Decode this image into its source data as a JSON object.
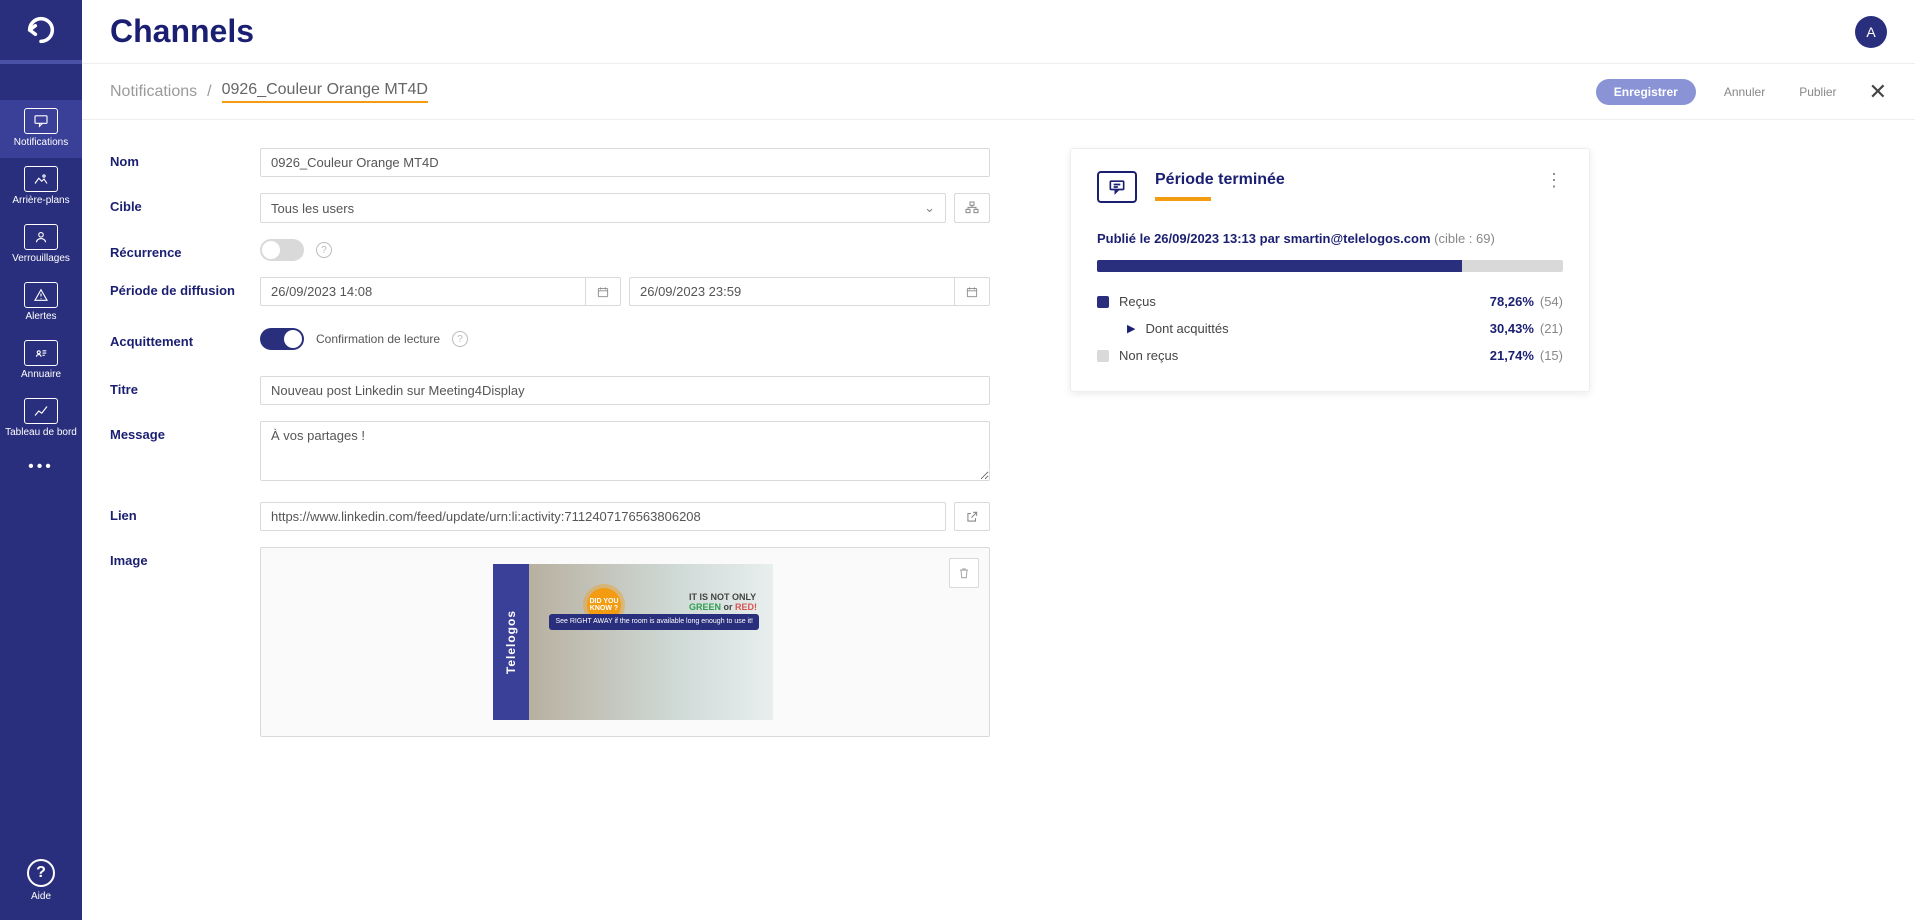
{
  "app": {
    "title": "Channels",
    "avatar": "A"
  },
  "breadcrumb": {
    "root": "Notifications",
    "leaf": "0926_Couleur Orange MT4D"
  },
  "actions": {
    "save": "Enregistrer",
    "cancel": "Annuler",
    "publish": "Publier"
  },
  "sidebar": {
    "items": [
      {
        "label": "Notifications"
      },
      {
        "label": "Arrière-plans"
      },
      {
        "label": "Verrouillages"
      },
      {
        "label": "Alertes"
      },
      {
        "label": "Annuaire"
      },
      {
        "label": "Tableau de bord"
      }
    ],
    "help": "Aide"
  },
  "form": {
    "labels": {
      "name": "Nom",
      "target": "Cible",
      "recurrence": "Récurrence",
      "period": "Période de diffusion",
      "ack": "Acquittement",
      "title": "Titre",
      "message": "Message",
      "link": "Lien",
      "image": "Image"
    },
    "values": {
      "name": "0926_Couleur Orange MT4D",
      "target": "Tous les users",
      "recurrence_on": false,
      "period_start": "26/09/2023 14:08",
      "period_end": "26/09/2023 23:59",
      "ack_on": true,
      "ack_label": "Confirmation de lecture",
      "title": "Nouveau post Linkedin sur Meeting4Display",
      "message": "À vos partages !",
      "link": "https://www.linkedin.com/feed/update/urn:li:activity:7112407176563806208"
    },
    "image_preview": {
      "brand": "Telelogos",
      "badge": "DID YOU KNOW ?",
      "line1": "IT IS NOT ONLY",
      "green": "GREEN",
      "or": " or ",
      "red": "RED!",
      "note": "See RIGHT AWAY if the room is available long enough to use it!"
    }
  },
  "panel": {
    "title": "Période terminée",
    "published_prefix": "Publié le ",
    "published_date": "26/09/2023 13:13",
    "published_by": " par ",
    "published_user": "smartin@telelogos.com",
    "target_label": "(cible : 69)",
    "progress_pct": 78.26,
    "stats": {
      "received": {
        "label": "Reçus",
        "pct": "78,26%",
        "count": "(54)"
      },
      "ack": {
        "label": "Dont acquittés",
        "pct": "30,43%",
        "count": "(21)"
      },
      "not": {
        "label": "Non reçus",
        "pct": "21,74%",
        "count": "(15)"
      }
    }
  }
}
